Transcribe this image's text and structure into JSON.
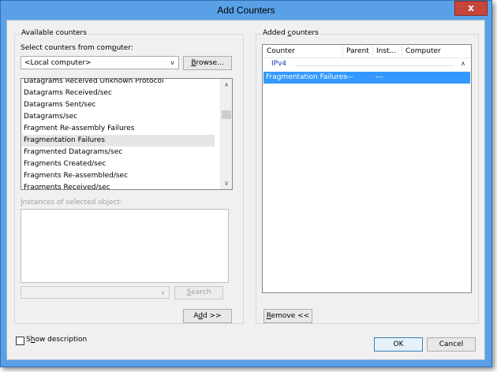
{
  "window": {
    "title": "Add Counters",
    "close_glyph": "x"
  },
  "available": {
    "group_label": "Available counters",
    "computer_label": "Select counters from computer:",
    "computer_value": "<Local computer>",
    "browse_label": "Browse...",
    "counters": [
      "Datagrams Received Unknown Protocol",
      "Datagrams Received/sec",
      "Datagrams Sent/sec",
      "Datagrams/sec",
      "Fragment Re-assembly Failures",
      "Fragmentation Failures",
      "Fragmented Datagrams/sec",
      "Fragments Created/sec",
      "Fragments Re-assembled/sec",
      "Fragments Received/sec"
    ],
    "selected_counter": "Fragmentation Failures",
    "instances_label": "Instances of selected object:",
    "search_value": "",
    "search_label": "Search",
    "add_label": "Add >>"
  },
  "added": {
    "group_label": "Added counters",
    "columns": [
      "Counter",
      "Parent",
      "Inst...",
      "Computer"
    ],
    "group_name": "IPv4",
    "rows": [
      {
        "counter": "Fragmentation Failures",
        "parent": "---",
        "instance": "---",
        "computer": ""
      }
    ],
    "remove_label": "Remove <<"
  },
  "footer": {
    "show_description_label": "Show description",
    "show_description_checked": false,
    "ok_label": "OK",
    "cancel_label": "Cancel"
  },
  "colors": {
    "titlebar": "#5aa0e6",
    "close": "#c7453a",
    "selection": "#3399ff",
    "group_text": "#1a3cb8"
  }
}
